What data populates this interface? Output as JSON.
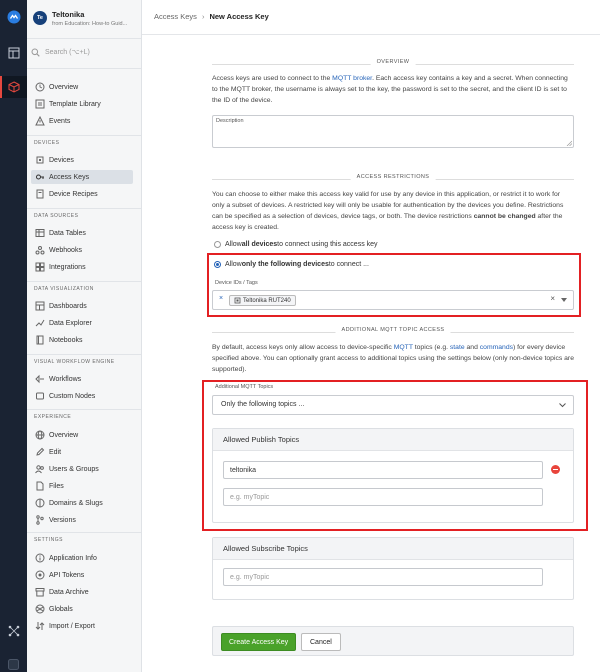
{
  "app": {
    "avatar": "Te",
    "name": "Teltonika",
    "subtitle": "from Education: How-to Guid..."
  },
  "search": {
    "placeholder": "Search (⌥+L)"
  },
  "sidebar": {
    "top": [
      {
        "label": "Overview",
        "icon": "overview-icon"
      },
      {
        "label": "Template Library",
        "icon": "library-icon"
      },
      {
        "label": "Events",
        "icon": "events-icon"
      }
    ],
    "sections": [
      {
        "title": "DEVICES",
        "items": [
          {
            "label": "Devices",
            "icon": "devices-icon"
          },
          {
            "label": "Access Keys",
            "icon": "key-icon",
            "active": true
          },
          {
            "label": "Device Recipes",
            "icon": "recipe-icon"
          }
        ]
      },
      {
        "title": "DATA SOURCES",
        "items": [
          {
            "label": "Data Tables",
            "icon": "table-icon"
          },
          {
            "label": "Webhooks",
            "icon": "webhook-icon"
          },
          {
            "label": "Integrations",
            "icon": "integrations-icon"
          }
        ]
      },
      {
        "title": "DATA VISUALIZATION",
        "items": [
          {
            "label": "Dashboards",
            "icon": "dashboard-icon"
          },
          {
            "label": "Data Explorer",
            "icon": "explorer-icon"
          },
          {
            "label": "Notebooks",
            "icon": "notebook-icon"
          }
        ]
      },
      {
        "title": "VISUAL WORKFLOW ENGINE",
        "items": [
          {
            "label": "Workflows",
            "icon": "workflow-icon"
          },
          {
            "label": "Custom Nodes",
            "icon": "custom-node-icon"
          }
        ]
      },
      {
        "title": "EXPERIENCE",
        "items": [
          {
            "label": "Overview",
            "icon": "globe-icon"
          },
          {
            "label": "Edit",
            "icon": "edit-icon"
          },
          {
            "label": "Users & Groups",
            "icon": "users-icon"
          },
          {
            "label": "Files",
            "icon": "files-icon"
          },
          {
            "label": "Domains & Slugs",
            "icon": "domains-icon"
          },
          {
            "label": "Versions",
            "icon": "versions-icon"
          }
        ]
      },
      {
        "title": "SETTINGS",
        "items": [
          {
            "label": "Application Info",
            "icon": "info-icon"
          },
          {
            "label": "API Tokens",
            "icon": "token-icon"
          },
          {
            "label": "Data Archive",
            "icon": "archive-icon"
          },
          {
            "label": "Globals",
            "icon": "globals-icon"
          },
          {
            "label": "Import / Export",
            "icon": "import-export-icon"
          }
        ]
      }
    ]
  },
  "breadcrumb": {
    "parent": "Access Keys",
    "separator": "›",
    "current": "New Access Key"
  },
  "overview": {
    "header": "OVERVIEW",
    "text_1": "Access keys are used to connect to the ",
    "link": "MQTT broker",
    "text_2": ". Each access key contains a key and a secret. When connecting to the MQTT broker, the username is always set to the key, the password is set to the secret, and the client ID is set to the ID of the device.",
    "description_label": "Description",
    "description_value": ""
  },
  "restrictions": {
    "header": "ACCESS RESTRICTIONS",
    "text_1": "You can choose to either make this access key valid for use by any device in this application, or restrict it to work for only a subset of devices. A restricted key will only be usable for authentication by the devices you define. Restrictions can be specified as a selection of devices, device tags, or both. The device restrictions ",
    "text_bold": "cannot be changed",
    "text_2": " after the access key is created.",
    "option_all_pre": "Allow ",
    "option_all_bold": "all devices",
    "option_all_post": " to connect using this access key",
    "option_only_pre": "Allow ",
    "option_only_bold": "only the following devices",
    "option_only_post": " to connect ...",
    "device_field_label": "Device IDs / Tags",
    "selected_tag": "Teltonika RUT240",
    "selected_option": "only"
  },
  "mqtt": {
    "header": "ADDITIONAL MQTT TOPIC ACCESS",
    "text_1": "By default, access keys only allow access to device-specific ",
    "link_1": "MQTT",
    "text_2": " topics (e.g. ",
    "link_2": "state",
    "text_3": " and ",
    "link_3": "commands",
    "text_4": ") for every device specified above. You can optionally grant access to additional topics using the settings below (only non-device topics are supported).",
    "topics_label": "Additional MQTT Topics",
    "topics_value": "Only the following topics ...",
    "publish_title": "Allowed Publish Topics",
    "publish_value": "teltonika",
    "publish_placeholder": "e.g. myTopic",
    "subscribe_title": "Allowed Subscribe Topics",
    "subscribe_placeholder": "e.g. myTopic"
  },
  "actions": {
    "create": "Create Access Key",
    "cancel": "Cancel"
  },
  "colors": {
    "rail": "#1a2333",
    "accent": "#2563b8",
    "primary_button": "#4aa22a",
    "highlight_box": "#e32023",
    "active_nav": "#dbe0e6"
  }
}
